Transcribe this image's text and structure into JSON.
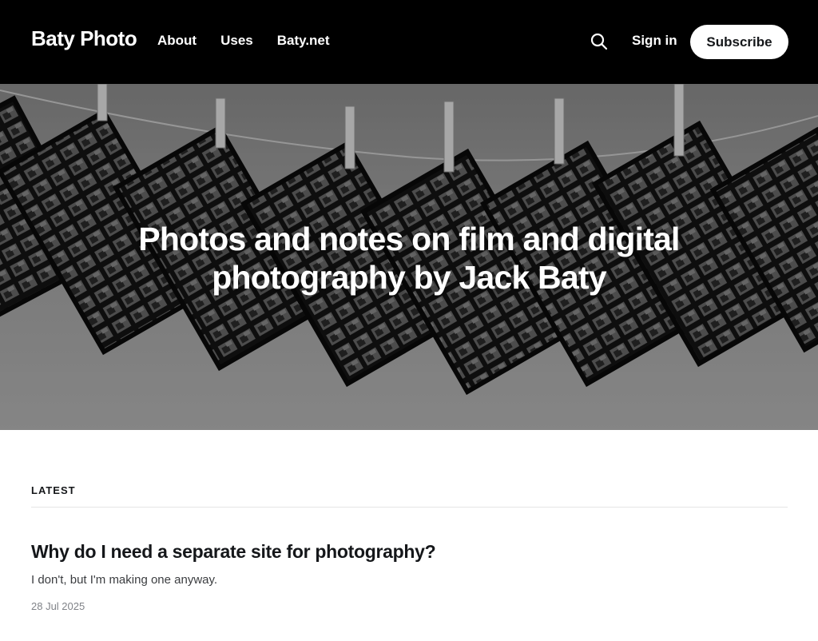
{
  "site": {
    "title": "Baty Photo"
  },
  "nav": {
    "items": [
      "About",
      "Uses",
      "Baty.net"
    ]
  },
  "header": {
    "sign_in": "Sign in",
    "subscribe": "Subscribe",
    "search_icon": "search-icon"
  },
  "hero": {
    "line1": "Photos and notes on film and digital",
    "line2": "photography by Jack Baty"
  },
  "feed": {
    "label": "LATEST",
    "posts": [
      {
        "title": "Why do I need a separate site for photography?",
        "excerpt": "I don't, but I'm making one anyway.",
        "date": "28 Jul 2025"
      }
    ]
  },
  "colors": {
    "header_bg": "#000000",
    "button_bg": "#ffffff",
    "text": "#15171a"
  }
}
